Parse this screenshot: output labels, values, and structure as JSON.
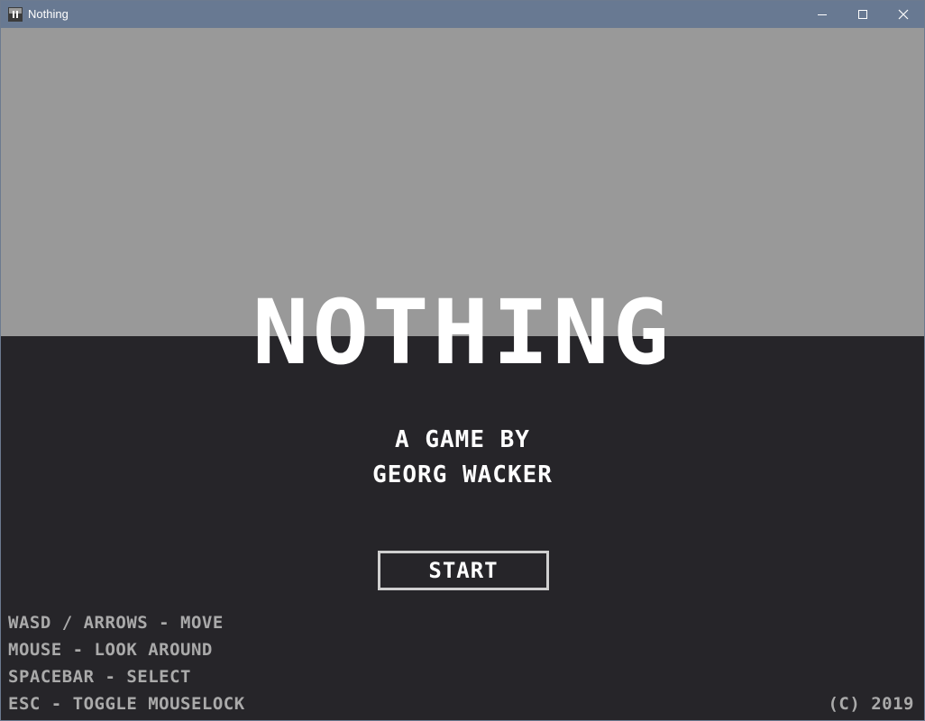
{
  "window": {
    "title": "Nothing",
    "controls": {
      "minimize_icon": "minimize-icon",
      "maximize_icon": "maximize-icon",
      "close_icon": "close-icon"
    }
  },
  "scene": {
    "sky_color": "#999999",
    "ground_color": "#262529"
  },
  "menu": {
    "title": "NOTHING",
    "credit_line_1": "A GAME BY",
    "credit_line_2": "GEORG WACKER",
    "start_label": "START"
  },
  "controls_help": [
    "WASD / ARROWS - MOVE",
    "MOUSE - LOOK AROUND",
    "SPACEBAR - SELECT",
    "ESC - TOGGLE MOUSELOCK"
  ],
  "copyright": "(C) 2019"
}
